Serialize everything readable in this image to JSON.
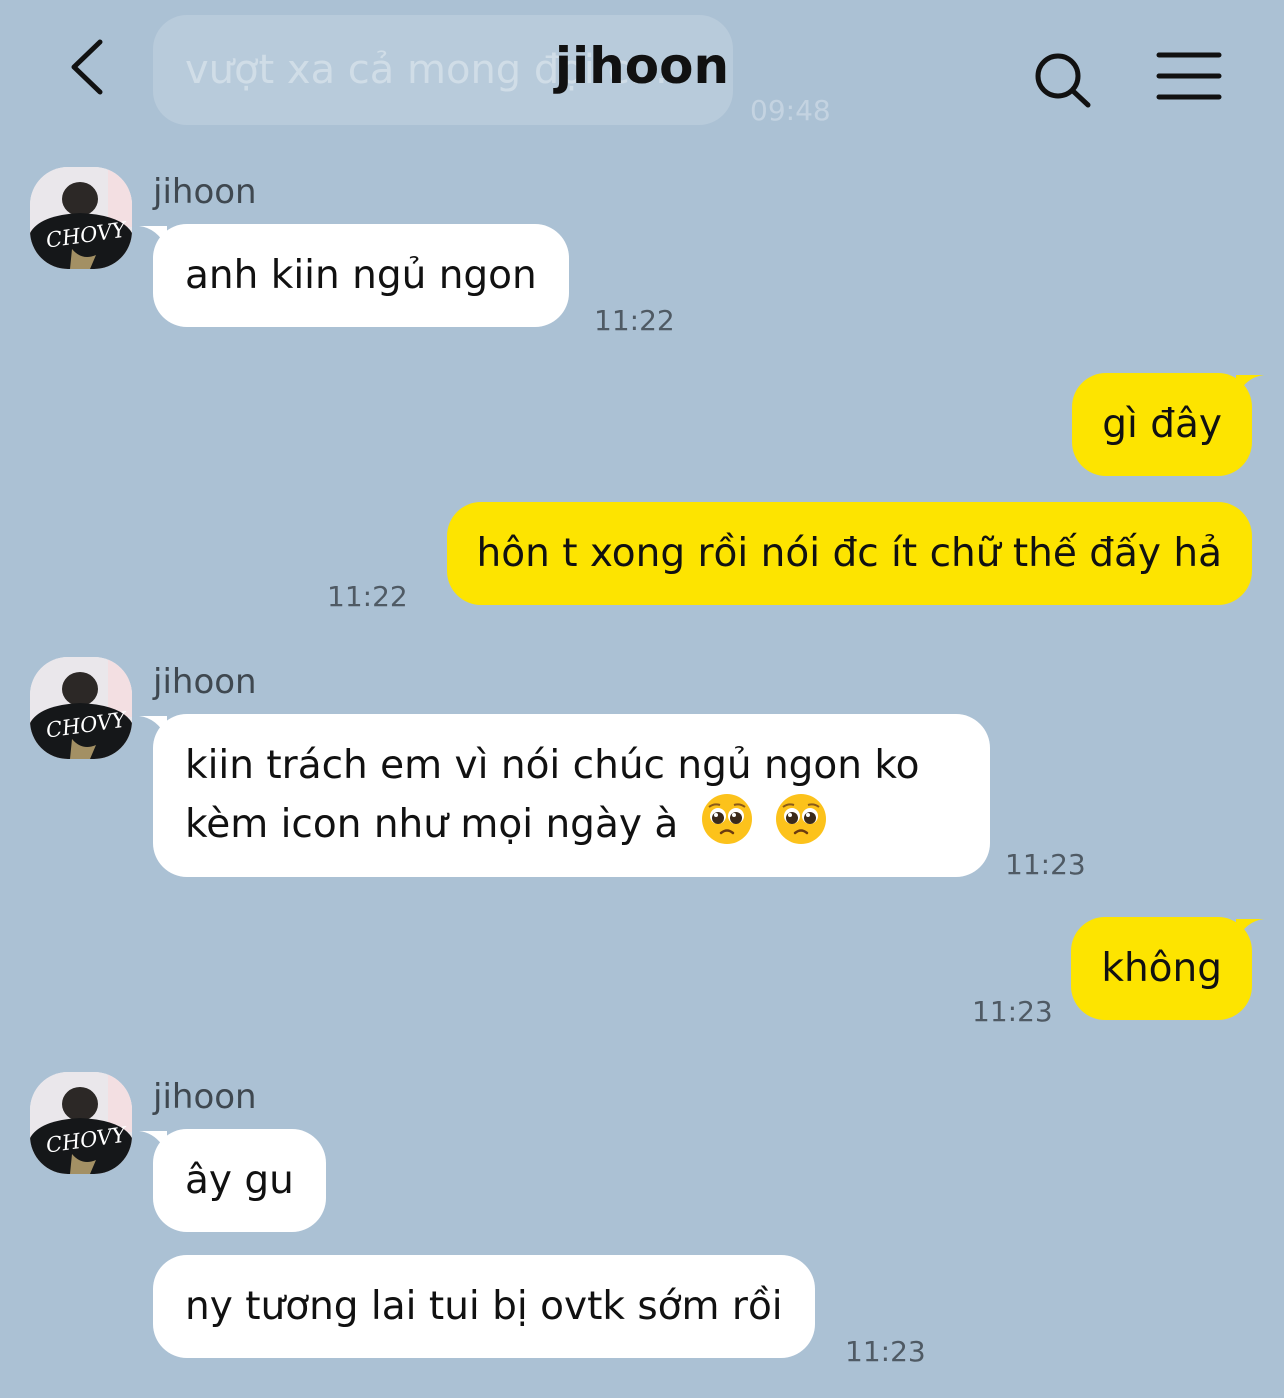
{
  "header": {
    "title": "jihoon",
    "ghost_preview": "vượt xa cả mong đợi c...",
    "ghost_time": "09:48",
    "back_icon": "chevron-left-icon",
    "search_icon": "search-icon",
    "menu_icon": "hamburger-menu-icon"
  },
  "colors": {
    "background": "#abc1d4",
    "incoming_bubble": "#ffffff",
    "outgoing_bubble": "#fde400"
  },
  "messages": [
    {
      "direction": "in",
      "sender": "jihoon",
      "text": "anh kiin ngủ ngon",
      "time": "11:22"
    },
    {
      "direction": "out",
      "text": "gì đây"
    },
    {
      "direction": "out",
      "text": "hôn t xong rồi nói đc ít chữ thế đấy hả",
      "time": "11:22"
    },
    {
      "direction": "in",
      "sender": "jihoon",
      "line1": "kiin trách em vì nói chúc ngủ ngon ko",
      "line2": "kèm icon như mọi ngày à",
      "emoji": "pleading-face-icon",
      "time": "11:23"
    },
    {
      "direction": "out",
      "text": "không",
      "time": "11:23"
    },
    {
      "direction": "in",
      "sender": "jihoon",
      "text": "ây gu"
    },
    {
      "direction": "in",
      "text": "ny tương lai tui bị ovtk sớm rồi",
      "time": "11:23"
    }
  ],
  "avatar": {
    "shirt_text": "CHOVY"
  }
}
